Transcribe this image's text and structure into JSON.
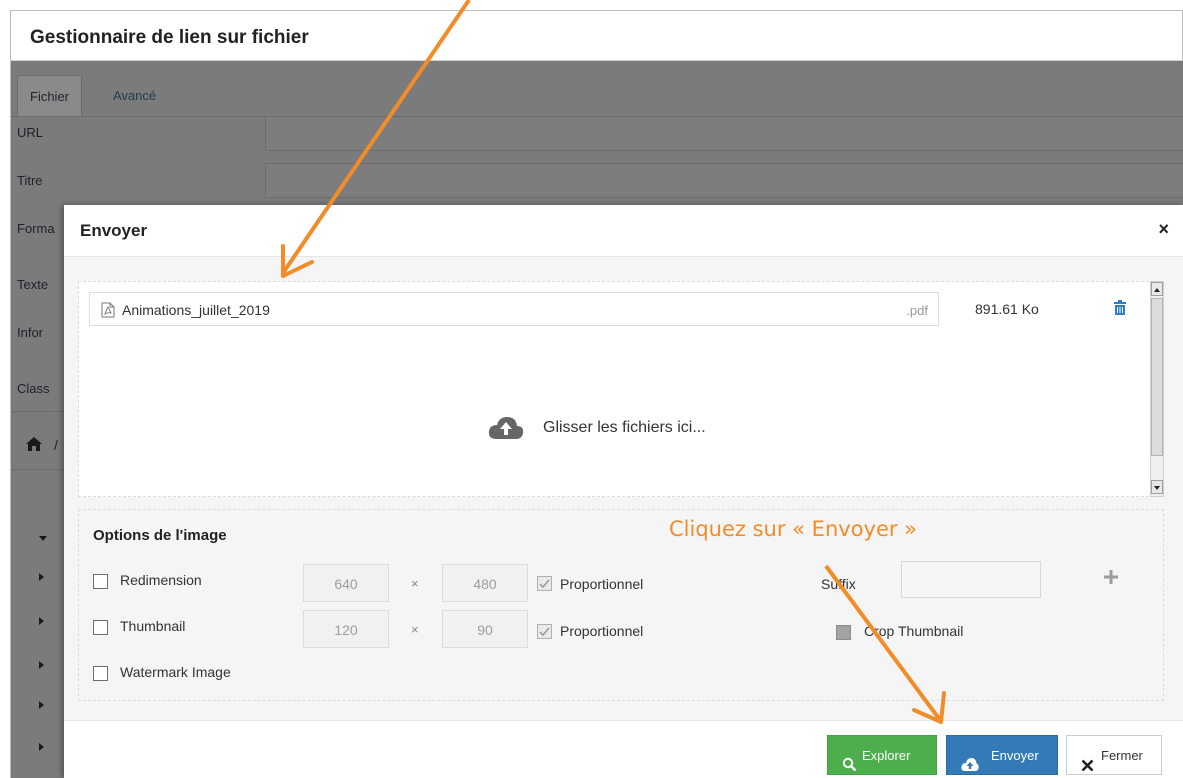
{
  "outer_dialog": {
    "title": "Gestionnaire de lien sur fichier",
    "tabs": [
      "Fichier",
      "Avancé"
    ],
    "fields": [
      {
        "label": "URL"
      },
      {
        "label": "Titre"
      },
      {
        "label": "Forma"
      }
    ],
    "partial_labels": [
      "Texte",
      "Infor",
      "Class"
    ],
    "breadcrumb_separator": "/"
  },
  "upload_modal": {
    "title": "Envoyer",
    "close_glyph": "×",
    "file": {
      "name": "Animations_juillet_2019",
      "extension": ".pdf",
      "size": "891.61 Ko",
      "icon": "pdf-file-icon"
    },
    "dropzone_text": "Glisser les fichiers ici...",
    "image_options": {
      "title": "Options de l'image",
      "resize": {
        "label": "Redimension",
        "width": "640",
        "height": "480",
        "proportional": "Proportionnel",
        "times": "×"
      },
      "thumbnail": {
        "label": "Thumbnail",
        "width": "120",
        "height": "90",
        "proportional": "Proportionnel",
        "times": "×"
      },
      "watermark": {
        "label": "Watermark Image"
      },
      "suffix": {
        "label": "Suffix",
        "value": ""
      },
      "crop_thumbnail": {
        "label": "Crop Thumbnail"
      }
    },
    "buttons": {
      "explorer": "Explorer",
      "envoyer": "Envoyer",
      "fermer": "Fermer"
    }
  },
  "annotation": {
    "text": "Cliquez sur « Envoyer »",
    "color": "#f28c28"
  },
  "colors": {
    "primary": "#337ab7",
    "success": "#4cae4c",
    "overlay": "#7b7b7b"
  }
}
